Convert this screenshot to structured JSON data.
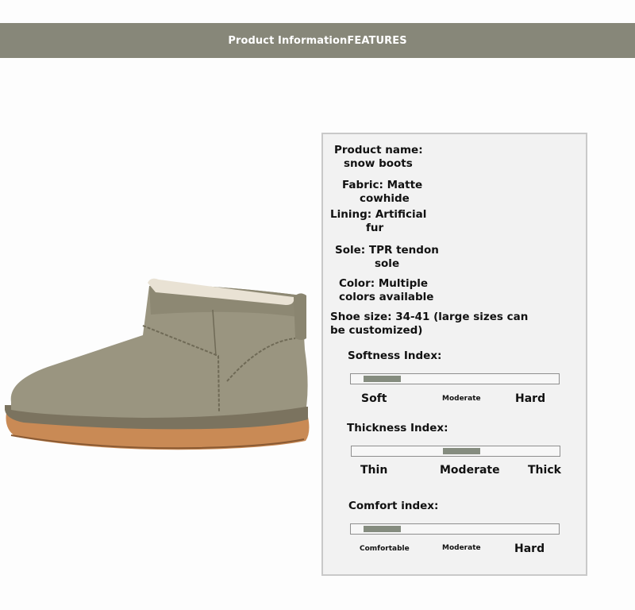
{
  "banner": {
    "title": "Product InformationFEATURES"
  },
  "product": {
    "name_label": "Product name:",
    "name_value": "snow boots",
    "fabric_label": "Fabric: Matte",
    "fabric_value": "cowhide",
    "lining_label": "Lining: Artificial",
    "lining_value": "fur",
    "sole_label": "Sole: TPR tendon",
    "sole_value": "sole",
    "color_label": "Color: Multiple",
    "color_value": "colors available",
    "size_line1": "Shoe size: 34-41 (large sizes can",
    "size_line2": "be customized)"
  },
  "indices": {
    "softness": {
      "title": "Softness Index:",
      "labels": [
        "Soft",
        "Moderate",
        "Hard"
      ],
      "level": 0.15
    },
    "thickness": {
      "title": "Thickness Index:",
      "labels": [
        "Thin",
        "Moderate",
        "Thick"
      ],
      "level": 0.5
    },
    "comfort": {
      "title": "Comfort index:",
      "labels": [
        "Comfortable",
        "Moderate",
        "Hard"
      ],
      "level": 0.15
    }
  },
  "colors": {
    "banner": "#878779",
    "slider_fill": "#858c7f",
    "boot_suede": "#9a9580",
    "sole": "#c98a55"
  }
}
